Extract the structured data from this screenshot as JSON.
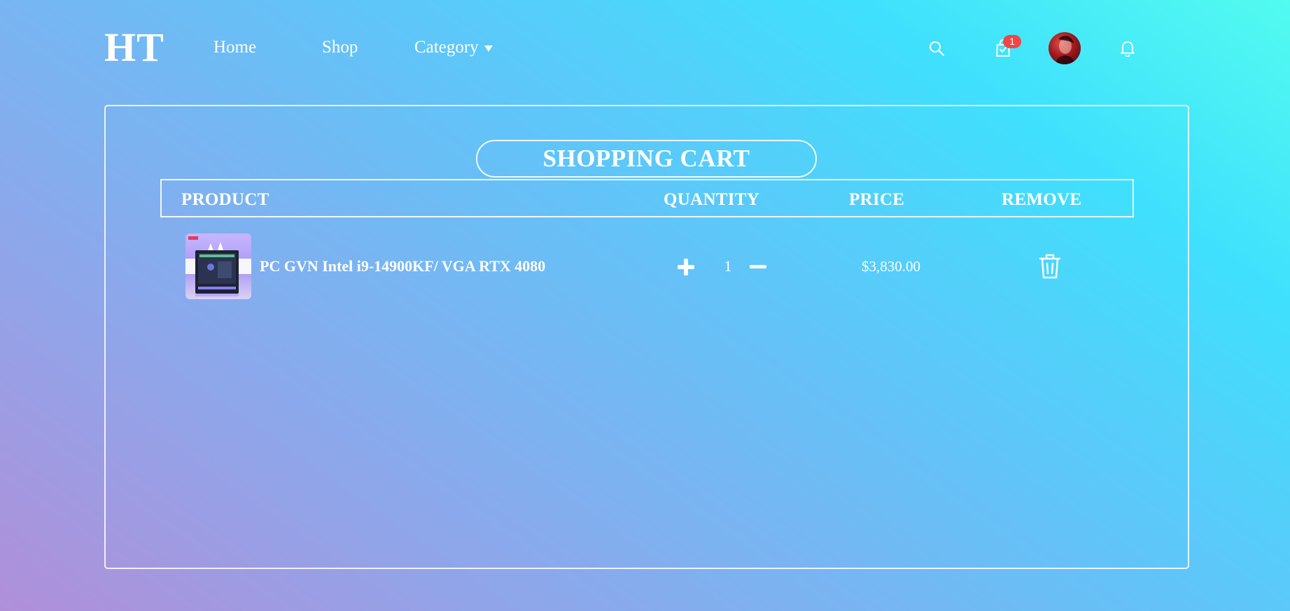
{
  "header": {
    "logo": "HT",
    "nav": {
      "home": "Home",
      "shop": "Shop",
      "category": "Category"
    },
    "icons": {
      "search": "search-icon",
      "cart": "shopping-bag-icon",
      "bell": "bell-icon",
      "caret": "caret-down-icon"
    },
    "cart_count": "1",
    "badge_color": "#f04646"
  },
  "cart": {
    "title": "SHOPPING CART",
    "columns": {
      "product": "PRODUCT",
      "quantity": "QUANTITY",
      "price": "PRICE",
      "remove": "REMOVE"
    },
    "items": [
      {
        "name": "PC GVN Intel i9-14900KF/ VGA RTX 4080",
        "quantity": "1",
        "price": "$3,830.00",
        "icons": {
          "increase": "plus-icon",
          "decrease": "minus-icon",
          "remove": "trash-icon"
        }
      }
    ]
  },
  "colors": {
    "gradient_start": "#b08fd9",
    "gradient_mid": "#62c3f8",
    "gradient_end": "#52fbef",
    "text": "#ffffff"
  }
}
